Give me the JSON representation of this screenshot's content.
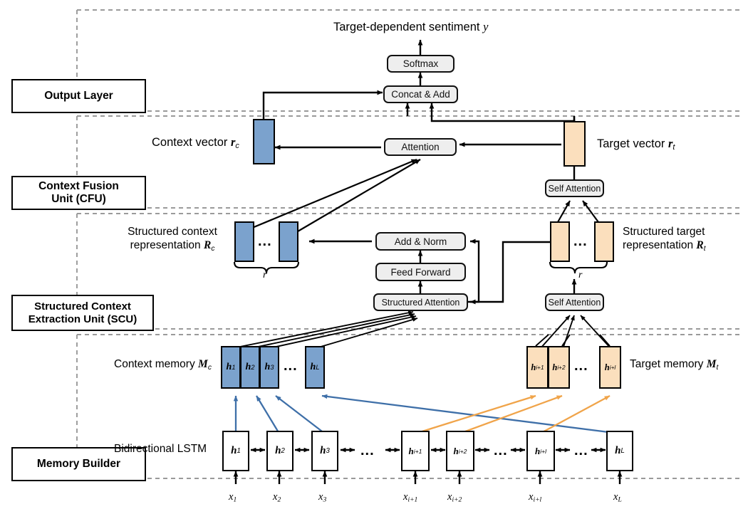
{
  "figure": {
    "title": "Target-dependent sentiment y",
    "type": "neural-network-architecture-diagram"
  },
  "colors": {
    "context_blue": "#7ba2cd",
    "target_orange": "#fbdfbd",
    "module_gray": "#eeeeee",
    "stroke": "#000000",
    "section_divider": "#9a9a9a",
    "context_arrow": "#3e6fa8",
    "target_arrow": "#f0a44a"
  },
  "sections": [
    {
      "id": "output-layer",
      "label": "Output Layer"
    },
    {
      "id": "cfu",
      "label": "Context Fusion\nUnit (CFU)",
      "line1": "Context Fusion",
      "line2": "Unit (CFU)"
    },
    {
      "id": "scu",
      "label": "Structured Context\nExtraction Unit (SCU)",
      "line1": "Structured Context",
      "line2": "Extraction Unit (SCU)"
    },
    {
      "id": "memory-builder",
      "label": "Memory Builder"
    }
  ],
  "output_layer": {
    "title": "Target-dependent  sentiment",
    "title_var": "y",
    "softmax": "Softmax",
    "concat_add": "Concat & Add"
  },
  "cfu": {
    "context_vector_label": "Context vector",
    "context_vector_var": "r",
    "context_vector_sub": "c",
    "target_vector_label": "Target vector",
    "target_vector_var": "r",
    "target_vector_sub": "t",
    "attention": "Attention",
    "self_attention": "Self Attention"
  },
  "scu": {
    "context_rep_line1": "Structured context",
    "context_rep_line2": "representation",
    "context_rep_var": "R",
    "context_rep_sub": "c",
    "target_rep_line1": "Structured target",
    "target_rep_line2": "representation",
    "target_rep_var": "R",
    "target_rep_sub": "t",
    "add_norm": "Add & Norm",
    "feed_forward": "Feed Forward",
    "structured_attention": "Structured Attention",
    "self_attention": "Self Attention",
    "brace_label": "r",
    "ellipsis": "..."
  },
  "memory_builder": {
    "context_memory_label": "Context memory",
    "context_memory_var": "M",
    "context_memory_sub": "c",
    "target_memory_label": "Target memory",
    "target_memory_var": "M",
    "target_memory_sub": "t",
    "bilstm_label": "Bidirectional LSTM",
    "ellipsis": "...",
    "context_memory_cells": [
      {
        "var": "h",
        "sub": "1"
      },
      {
        "var": "h",
        "sub": "2"
      },
      {
        "var": "h",
        "sub": "3"
      },
      {
        "var": "h",
        "sub": "L"
      }
    ],
    "target_memory_cells": [
      {
        "var": "h",
        "sub": "i+1"
      },
      {
        "var": "h",
        "sub": "i+2"
      },
      {
        "var": "h",
        "sub": "i+l"
      }
    ],
    "lstm_cells": [
      {
        "var": "h",
        "sub": "1"
      },
      {
        "var": "h",
        "sub": "2"
      },
      {
        "var": "h",
        "sub": "3"
      },
      {
        "var": "h",
        "sub": "i+1"
      },
      {
        "var": "h",
        "sub": "i+2"
      },
      {
        "var": "h",
        "sub": "i+l"
      },
      {
        "var": "h",
        "sub": "L"
      }
    ],
    "inputs": [
      {
        "var": "x",
        "sub": "1"
      },
      {
        "var": "x",
        "sub": "2"
      },
      {
        "var": "x",
        "sub": "3"
      },
      {
        "var": "x",
        "sub": "i+1"
      },
      {
        "var": "x",
        "sub": "i+2"
      },
      {
        "var": "x",
        "sub": "i+l"
      },
      {
        "var": "x",
        "sub": "L"
      }
    ]
  }
}
